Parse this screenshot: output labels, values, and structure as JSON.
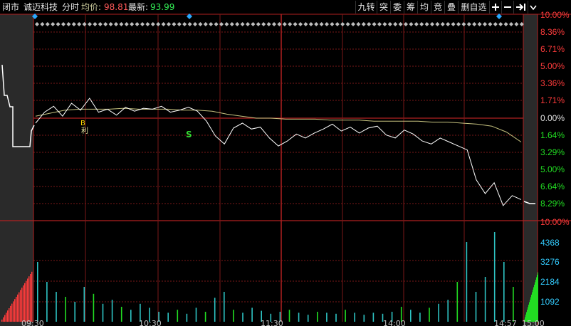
{
  "header": {
    "status": "闭市",
    "stock_name": "诚迈科技",
    "mode": "分时",
    "avg_label": "均价:",
    "avg_value": "98.81",
    "last_label": "最新:",
    "last_value": "93.99"
  },
  "toolbar": {
    "buttons": [
      "九转",
      "突",
      "委",
      "筹",
      "均",
      "竞",
      "叠",
      "删自选"
    ],
    "icons": [
      "plus-icon",
      "minus-icon",
      "expand-right-icon",
      "chevron-down-icon"
    ]
  },
  "axes": {
    "right_price_pct": [
      "10.00%",
      "8.36%",
      "6.71%",
      "5.00%",
      "3.36%",
      "1.71%",
      "0.00%",
      "1.64%",
      "3.29%",
      "5.00%",
      "6.64%",
      "8.29%"
    ],
    "right_volume": [
      "10.00%",
      "4368",
      "3276",
      "2184",
      "1092"
    ],
    "time_labels": [
      "09:30",
      "10:30",
      "11:30",
      "14:00",
      "14:57",
      "15:00"
    ]
  },
  "markers": [
    {
      "text": "B",
      "label": "利"
    },
    {
      "text": "S"
    }
  ],
  "colors": {
    "price_line": "#ffffff",
    "avg_line": "#c8c480",
    "grid": "#7a1717",
    "zero_line": "#b02020",
    "up": "#ff3b3b",
    "down": "#22dd22",
    "neutral_vol": "#2ec4c4",
    "pct_text": "#ff3b3b",
    "vol_text": "#33ccff"
  },
  "chart_data": {
    "type": "line",
    "title": "",
    "series": [
      {
        "values": [
          -0.5,
          0.6,
          1.2,
          0.2,
          1.5,
          0.8,
          2.0,
          0.6,
          0.9,
          0.3,
          1.1,
          0.7,
          1.0,
          0.9,
          1.2,
          0.6,
          0.8,
          1.1,
          0.7,
          -0.3,
          -1.8,
          -2.6,
          -1.0,
          -0.5,
          -1.1,
          -0.9,
          -2.0,
          -2.8,
          -2.3,
          -1.6,
          -2.0,
          -1.5,
          -1.1,
          -0.6,
          -1.3,
          -0.9,
          -1.5,
          -1.0,
          -0.8,
          -1.7,
          -2.0,
          -1.2,
          -1.6,
          -2.3,
          -2.6,
          -2.0,
          -2.4,
          -2.8,
          -3.2,
          -6.2,
          -7.6,
          -6.5,
          -8.8,
          -7.8,
          -8.2
        ]
      },
      {
        "values": [
          0.2,
          0.5,
          0.8,
          0.9,
          0.9,
          0.9,
          1.0,
          0.9,
          0.9,
          0.9,
          0.8,
          0.8,
          0.7,
          0.4,
          0.2,
          0.0,
          0.0,
          -0.1,
          -0.1,
          -0.1,
          -0.2,
          -0.2,
          -0.2,
          -0.3,
          -0.3,
          -0.3,
          -0.3,
          -0.4,
          -0.4,
          -0.5,
          -0.6,
          -0.8,
          -1.4,
          -2.4
        ]
      }
    ],
    "volume": [
      60,
      40,
      30,
      25,
      20,
      35,
      28,
      18,
      22,
      15,
      12,
      18,
      14,
      10,
      9,
      12,
      8,
      14,
      10,
      24,
      30,
      12,
      9,
      14,
      11,
      8,
      10,
      12,
      9,
      7,
      10,
      9,
      8,
      12,
      9,
      7,
      9,
      8,
      10,
      15,
      12,
      9,
      14,
      18,
      22,
      40,
      80,
      30,
      45,
      90,
      60,
      35
    ],
    "ylim_pct": [
      -10,
      10
    ],
    "volume_ticks": [
      1092,
      2184,
      3276,
      4368
    ]
  }
}
